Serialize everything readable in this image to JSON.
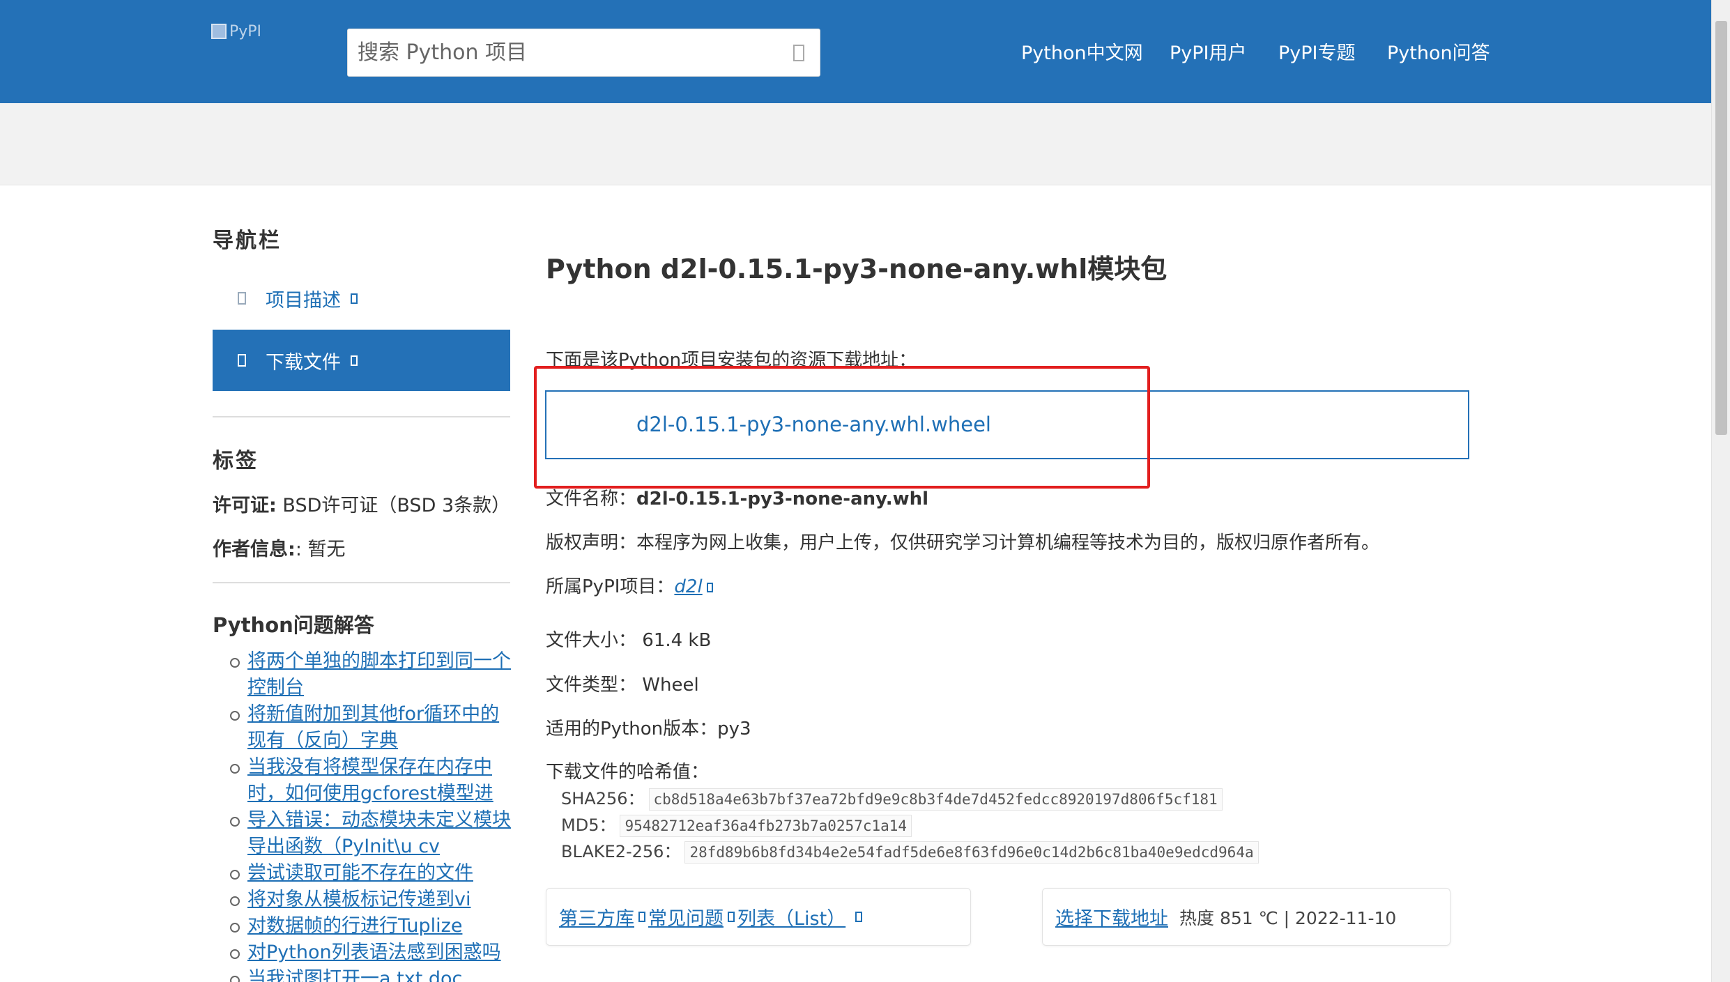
{
  "header": {
    "logo_alt": "PyPI",
    "search_placeholder": "搜索 Python 项目",
    "nav": [
      "Python中文网",
      "PyPI用户",
      "PyPI专题",
      "Python问答"
    ]
  },
  "sidebar": {
    "nav_title": "导航栏",
    "items": [
      {
        "label": "项目描述",
        "active": false
      },
      {
        "label": "下载文件",
        "active": true
      }
    ],
    "tags_title": "标签",
    "license_label": "许可证:",
    "license_value": "BSD许可证（BSD 3条款）",
    "author_label": "作者信息:",
    "author_value": ": 暂无",
    "qa_title": "Python问题解答",
    "qa_items": [
      "将两个单独的脚本打印到同一个控制台",
      "将新值附加到其他for循环中的现有（反向）字典",
      "当我没有将模型保存在内存中时，如何使用gcforest模型进",
      "导入错误：动态模块未定义模块导出函数（PyInit\\u cv",
      "尝试读取可能不存在的文件",
      "将对象从模板标记传递到vi",
      "对数据帧的行进行Tuplize",
      "对Python列表语法感到困惑吗",
      "当我试图打开一a.txt.doc"
    ]
  },
  "main": {
    "title": "Python d2l-0.15.1-py3-none-any.whl模块包",
    "intro": "下面是该Python项目安装包的资源下载地址：",
    "download_link": "d2l-0.15.1-py3-none-any.whl.wheel",
    "filename_label": "文件名称：",
    "filename_value": "d2l-0.15.1-py3-none-any.whl",
    "copyright": "版权声明：本程序为网上收集，用户上传，仅供研究学习计算机编程等技术为目的，版权归原作者所有。",
    "project_label": "所属PyPI项目：",
    "project_value": "d2l",
    "size_label": "文件大小：",
    "size_value": "61.4 kB",
    "type_label": "文件类型：",
    "type_value": "Wheel",
    "pyver_label": "适用的Python版本：",
    "pyver_value": "py3",
    "hash_title": "下载文件的哈希值：",
    "sha256_label": "SHA256：",
    "sha256": "cb8d518a4e63b7bf37ea72bfd9e9c8b3f4de7d452fedcc8920197d806f5cf181",
    "md5_label": "MD5：",
    "md5": "95482712eaf36a4fb273b7a0257c1a14",
    "blake_label": "BLAKE2-256：",
    "blake": "28fd89b6b8fd34b4e2e54fadf5de6e8f63fd96e0c14d2b6c81ba40e9edcd964a"
  },
  "footer_cards": {
    "links": [
      "第三方库",
      "常见问题",
      "列表（List）"
    ],
    "choose_label": "选择下载地址",
    "heat": "热度 851 ℃ | 2022-11-10"
  },
  "colors": {
    "brand": "#2471b7",
    "highlight": "#e21f1f",
    "link": "#1e6fb5"
  }
}
